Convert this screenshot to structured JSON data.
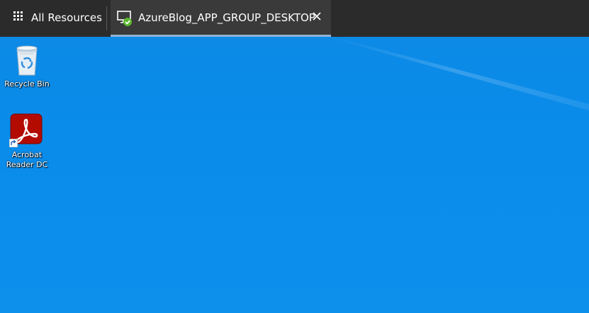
{
  "topbar": {
    "all_resources_label": "All Resources",
    "grid_icon": "app-launcher-grid-icon",
    "tabs": [
      {
        "label": "AzureBlog_APP_GROUP_DESKTOP",
        "icon": "monitor-connected-icon",
        "status_color": "#5cb82e",
        "close_icon": "close-icon",
        "active": true
      }
    ]
  },
  "desktop": {
    "background_color": "#0a8ceb",
    "icons": [
      {
        "label": "Recycle Bin",
        "icon": "recycle-bin-icon"
      },
      {
        "label": "Acrobat\nReader DC",
        "icon": "acrobat-reader-icon",
        "shortcut": true,
        "brand_color": "#b30b00"
      }
    ]
  }
}
